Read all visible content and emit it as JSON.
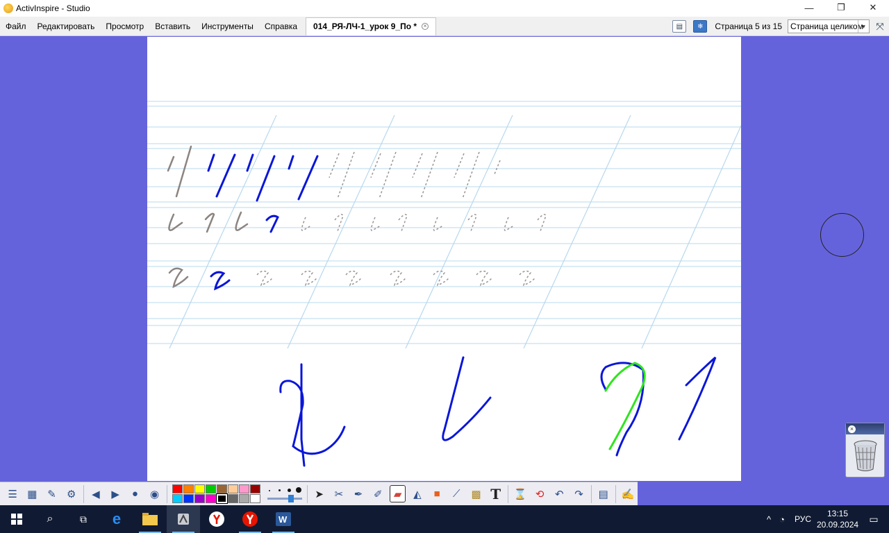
{
  "window": {
    "title": "ActivInspire - Studio",
    "minimize": "—",
    "maximize": "❐",
    "close": "✕"
  },
  "menu": {
    "items": [
      "Файл",
      "Редактировать",
      "Просмотр",
      "Вставить",
      "Инструменты",
      "Справка"
    ]
  },
  "document_tab": {
    "label": "014_РЯ-ЛЧ-1_урок 9_По *",
    "close": "×"
  },
  "page_indicator": "Страница 5 из 15",
  "zoom": {
    "selected": "Страница целиком"
  },
  "palette": {
    "colors": [
      "#ff0000",
      "#ff8000",
      "#ffff00",
      "#00cc00",
      "#996633",
      "#ffcc99",
      "#ff99cc",
      "#990000",
      "#00ccff",
      "#0033ff",
      "#9900cc",
      "#ff00cc",
      "#000000",
      "#666666",
      "#aaaaaa",
      "#ffffff"
    ],
    "selected": "#000000"
  },
  "ink_colors": {
    "blue": "#0a16d8",
    "green": "#2ee51e",
    "gray": "#8c8480",
    "guideline": "#b7d8ee"
  },
  "toolbox_icons": [
    "main-menu-icon",
    "browser-icon",
    "flipchart-icon",
    "settings-icon",
    "prev-page-icon",
    "next-page-icon",
    "play-icon",
    "desktop-annotate-icon",
    "select-icon",
    "tools-icon",
    "pen-icon",
    "highlighter-icon",
    "eraser-icon",
    "fill-icon",
    "shape-icon",
    "connector-icon",
    "clipart-icon",
    "text-icon",
    "clear-icon",
    "reset-icon",
    "undo-icon",
    "redo-icon",
    "page-icon",
    "pin-icon"
  ],
  "taskbar": {
    "apps": [
      "start-icon",
      "search-icon",
      "task-view-icon",
      "edge-icon",
      "file-explorer-icon",
      "activinspire-icon",
      "yandex-icon",
      "yandex-browser-icon",
      "word-icon"
    ],
    "language": "РУС",
    "time": "13:15",
    "date": "20.09.2024"
  }
}
